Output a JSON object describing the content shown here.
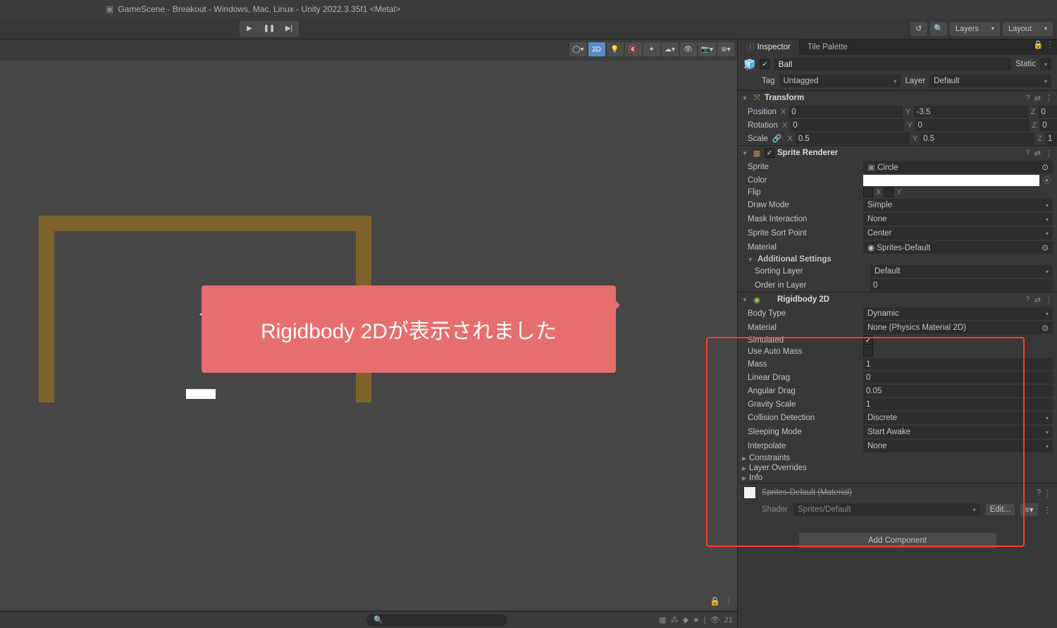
{
  "window_title": "GameScene - Breakout - Windows, Mac, Linux - Unity 2022.3.35f1 <Metal>",
  "toolbar": {
    "layers_label": "Layers",
    "layout_label": "Layout"
  },
  "scene_toolbar": {
    "mode_2d": "2D",
    "persp_count": "21"
  },
  "tabs": {
    "inspector": "Inspector",
    "tile_palette": "Tile Palette"
  },
  "object": {
    "name": "Ball",
    "active": true,
    "static_label": "Static",
    "tag_label": "Tag",
    "tag_value": "Untagged",
    "layer_label": "Layer",
    "layer_value": "Default"
  },
  "transform": {
    "title": "Transform",
    "pos_label": "Position",
    "px": "0",
    "py": "-3.5",
    "pz": "0",
    "rot_label": "Rotation",
    "rx": "0",
    "ry": "0",
    "rz": "0",
    "scl_label": "Scale",
    "sx": "0.5",
    "sy": "0.5",
    "sz": "1"
  },
  "sprite": {
    "title": "Sprite Renderer",
    "sprite_label": "Sprite",
    "sprite_value": "Circle",
    "color_label": "Color",
    "flip_label": "Flip",
    "flip_x": "X",
    "flip_y": "Y",
    "draw_label": "Draw Mode",
    "draw_value": "Simple",
    "mask_label": "Mask Interaction",
    "mask_value": "None",
    "sort_label": "Sprite Sort Point",
    "sort_value": "Center",
    "mat_label": "Material",
    "mat_value": "Sprites-Default",
    "addl_label": "Additional Settings",
    "slayer_label": "Sorting Layer",
    "slayer_value": "Default",
    "order_label": "Order in Layer",
    "order_value": "0"
  },
  "rigidbody": {
    "title": "Rigidbody 2D",
    "body_label": "Body Type",
    "body_value": "Dynamic",
    "mat_label": "Material",
    "mat_value": "None (Physics Material 2D)",
    "sim_label": "Simulated",
    "sim_value": true,
    "auto_label": "Use Auto Mass",
    "auto_value": false,
    "mass_label": "Mass",
    "mass_value": "1",
    "ldrag_label": "Linear Drag",
    "ldrag_value": "0",
    "adrag_label": "Angular Drag",
    "adrag_value": "0.05",
    "grav_label": "Gravity Scale",
    "grav_value": "1",
    "coll_label": "Collision Detection",
    "coll_value": "Discrete",
    "sleep_label": "Sleeping Mode",
    "sleep_value": "Start Awake",
    "interp_label": "Interpolate",
    "interp_value": "None",
    "constraints_label": "Constraints",
    "overrides_label": "Layer Overrides",
    "info_label": "Info"
  },
  "material": {
    "name": "Sprites-Default (Material)",
    "shader_label": "Shader",
    "shader_value": "Sprites/Default",
    "edit_label": "Edit..."
  },
  "add_component": "Add Component",
  "callout": "Rigidbody 2Dが表示されました"
}
